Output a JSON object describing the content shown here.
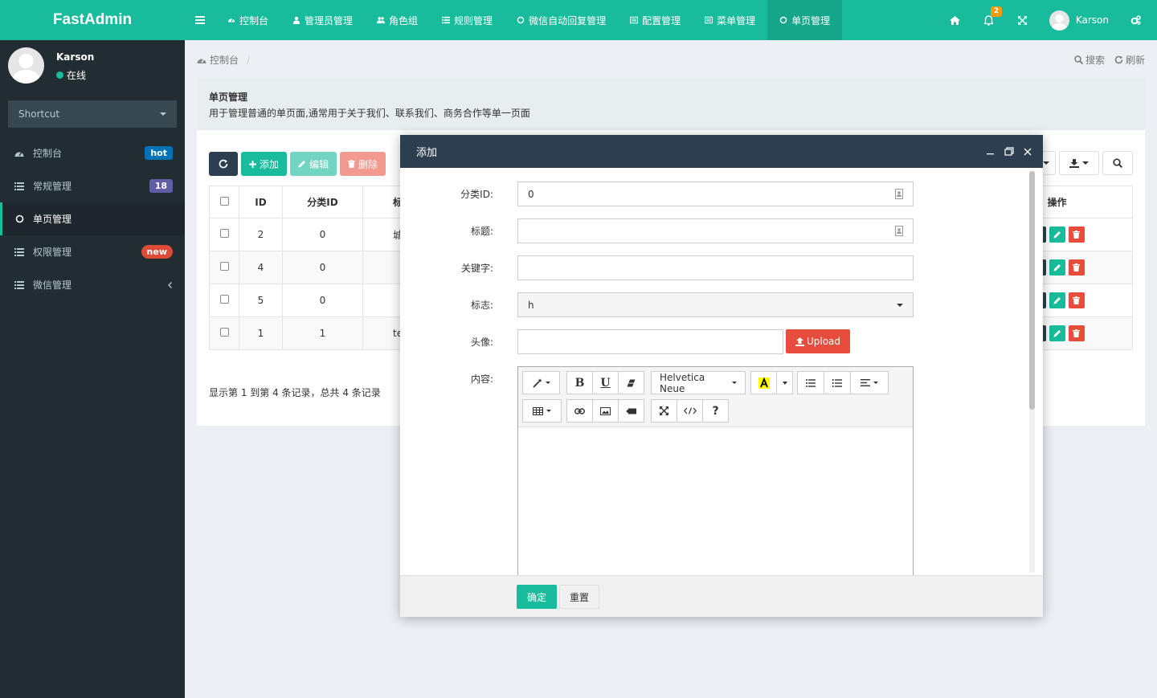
{
  "app": {
    "logo": "FastAdmin"
  },
  "topnav": {
    "tabs": [
      {
        "label": "控制台",
        "icon": "dashboard-icon"
      },
      {
        "label": "管理员管理",
        "icon": "user-icon"
      },
      {
        "label": "角色组",
        "icon": "group-icon"
      },
      {
        "label": "规则管理",
        "icon": "list-icon"
      },
      {
        "label": "微信自动回复管理",
        "icon": "circle-icon"
      },
      {
        "label": "配置管理",
        "icon": "config-icon"
      },
      {
        "label": "菜单管理",
        "icon": "config-icon"
      },
      {
        "label": "单页管理",
        "icon": "circle-icon",
        "active": true
      }
    ],
    "notifications": "2",
    "user": "Karson"
  },
  "sidebar": {
    "user": {
      "name": "Karson",
      "status": "在线"
    },
    "shortcut": "Shortcut",
    "items": [
      {
        "label": "控制台",
        "badge": "hot",
        "badge_color": "#0073b7"
      },
      {
        "label": "常规管理",
        "badge": "18",
        "badge_color": "#605ca8"
      },
      {
        "label": "单页管理",
        "active": true
      },
      {
        "label": "权限管理",
        "badge": "new",
        "badge_color": "#dd4b39"
      },
      {
        "label": "微信管理",
        "collapsible": true
      }
    ]
  },
  "breadcrumb": {
    "home": "控制台",
    "search": "搜索",
    "refresh": "刷新"
  },
  "panel": {
    "title": "单页管理",
    "description": "用于管理普通的单页面,通常用于关于我们、联系我们、商务合作等单一页面"
  },
  "toolbar": {
    "add": "添加",
    "edit": "编辑",
    "delete": "删除"
  },
  "table": {
    "columns": [
      "ID",
      "分类ID",
      "标",
      "操作"
    ],
    "rows": [
      {
        "id": "2",
        "category_id": "0",
        "title": "城"
      },
      {
        "id": "4",
        "category_id": "0",
        "title": ""
      },
      {
        "id": "5",
        "category_id": "0",
        "title": ""
      },
      {
        "id": "1",
        "category_id": "1",
        "title": "te"
      }
    ],
    "summary": "显示第 1 到第 4 条记录，总共 4 条记录"
  },
  "modal": {
    "title": "添加",
    "fields": {
      "category_id": {
        "label": "分类ID:",
        "value": "0"
      },
      "title": {
        "label": "标题:",
        "value": ""
      },
      "keywords": {
        "label": "关键字:",
        "value": ""
      },
      "flag": {
        "label": "标志:",
        "value": "h"
      },
      "avatar": {
        "label": "头像:",
        "value": "",
        "upload": "Upload"
      },
      "content": {
        "label": "内容:",
        "font": "Helvetica Neue",
        "bold": "B",
        "underline": "U",
        "help": "?"
      }
    },
    "submit": "确定",
    "reset": "重置"
  }
}
